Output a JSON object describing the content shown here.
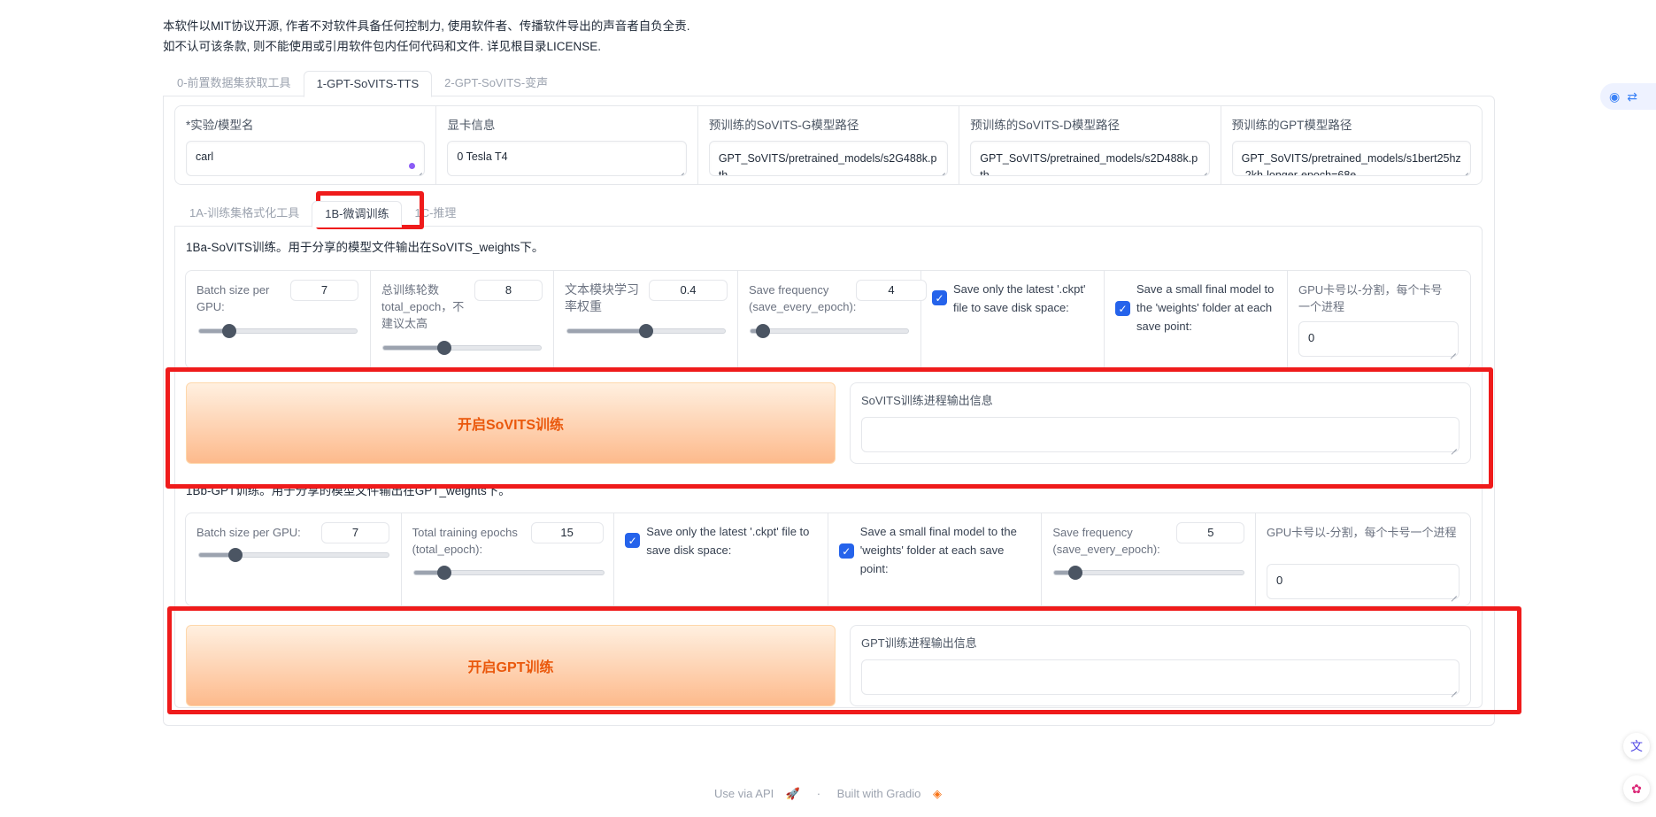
{
  "notice": {
    "line1": "本软件以MIT协议开源, 作者不对软件具备任何控制力, 使用软件者、传播软件导出的声音者自负全责.",
    "line2": "如不认可该条款, 则不能使用或引用软件包内任何代码和文件. 详见根目录LICENSE."
  },
  "top_tabs": [
    "0-前置数据集获取工具",
    "1-GPT-SoVITS-TTS",
    "2-GPT-SoVITS-变声"
  ],
  "model_row": {
    "exp_name_label": "*实验/模型名",
    "exp_name_value": "carl",
    "gpu_info_label": "显卡信息",
    "gpu_info_value": "0 Tesla T4",
    "sovits_g_label": "预训练的SoVITS-G模型路径",
    "sovits_g_value": "GPT_SoVITS/pretrained_models/s2G488k.pth",
    "sovits_d_label": "预训练的SoVITS-D模型路径",
    "sovits_d_value": "GPT_SoVITS/pretrained_models/s2D488k.pth",
    "gpt_label": "预训练的GPT模型路径",
    "gpt_value": "GPT_SoVITS/pretrained_models/s1bert25hz-2kh-longer-epoch=68e"
  },
  "sub_tabs": [
    "1A-训练集格式化工具",
    "1B-微调训练",
    "1C-推理"
  ],
  "sovits": {
    "title": "1Ba-SoVITS训练。用于分享的模型文件输出在SoVITS_weights下。",
    "batch_label": "Batch size per GPU:",
    "batch_value": "7",
    "batch_level": 0.19,
    "epoch_label": "总训练轮数total_epoch，不建议太高",
    "epoch_value": "8",
    "epoch_level": 0.39,
    "text_lr_label": "文本模块学习率权重",
    "text_lr_value": "0.4",
    "text_lr_level": 0.5,
    "save_freq_label": "Save frequency (save_every_epoch):",
    "save_freq_value": "4",
    "save_freq_level": 0.08,
    "latest_ckpt_label": "Save only the latest '.ckpt' file to save disk space:",
    "small_final_label": "Save a small final model to the 'weights' folder at each save point:",
    "gpu_label": "GPU卡号以-分割，每个卡号一个进程",
    "gpu_value": "0",
    "start_button": "开启SoVITS训练",
    "output_label": "SoVITS训练进程输出信息"
  },
  "gpt": {
    "title": "1Bb-GPT训练。用于分享的模型文件输出在GPT_weights下。",
    "batch_label": "Batch size per GPU:",
    "batch_value": "7",
    "batch_level": 0.19,
    "epoch_label": "Total training epochs (total_epoch):",
    "epoch_value": "15",
    "epoch_level": 0.16,
    "latest_ckpt_label": "Save only the latest '.ckpt' file to save disk space:",
    "small_final_label": "Save a small final model to the 'weights' folder at each save point:",
    "save_freq_label": "Save frequency (save_every_epoch):",
    "save_freq_value": "5",
    "save_freq_level": 0.11,
    "gpu_label": "GPU卡号以-分割，每个卡号一个进程",
    "gpu_value": "0",
    "start_button": "开启GPT训练",
    "output_label": "GPT训练进程输出信息"
  },
  "footer": {
    "api": "Use via API",
    "dot": "·",
    "built": "Built with Gradio"
  },
  "colors": {
    "accent_orange": "#ea580c",
    "checkbox_blue": "#2563eb",
    "highlight_red": "#ef1b1b"
  }
}
